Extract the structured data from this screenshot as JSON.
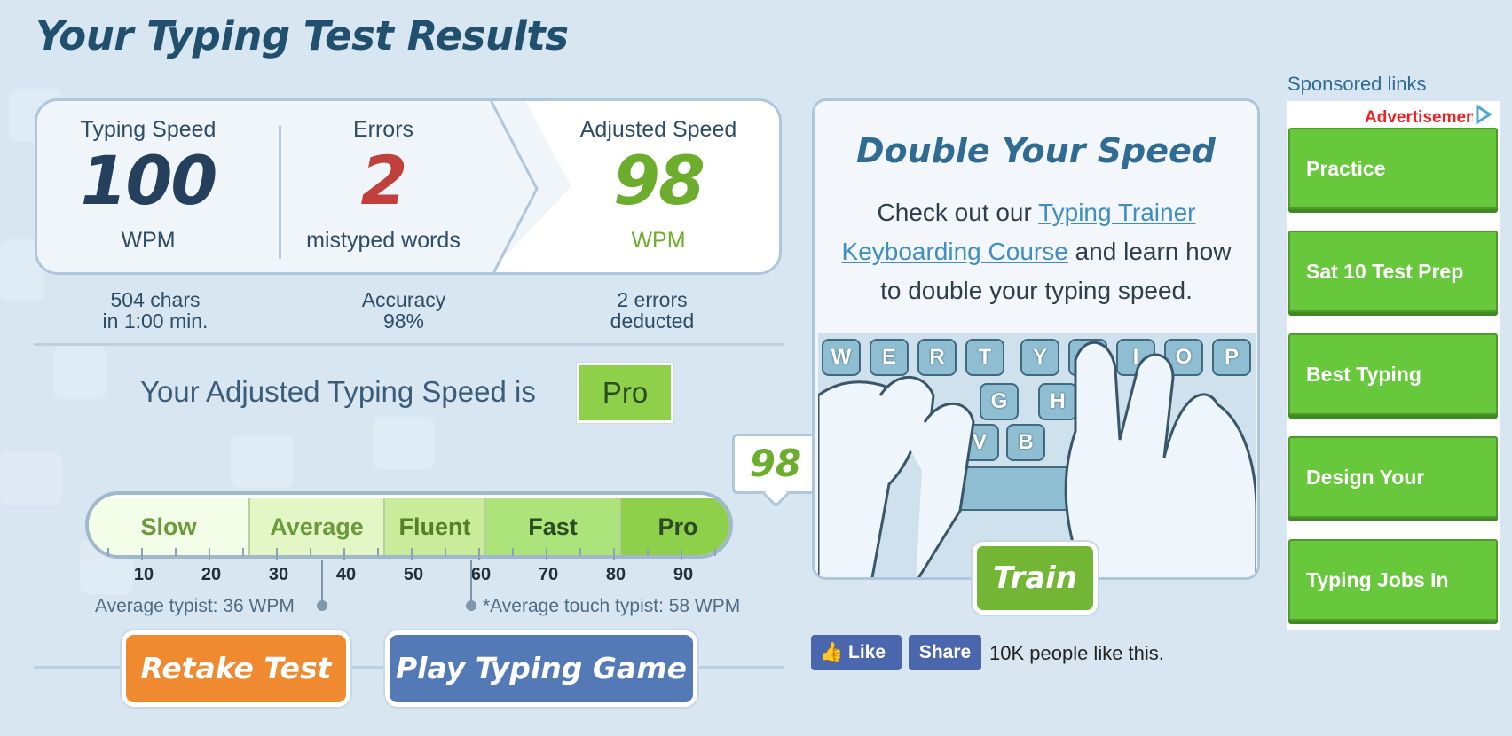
{
  "page": {
    "title": "Your Typing Test Results"
  },
  "results": {
    "typing_speed": {
      "label": "Typing Speed",
      "value": "100",
      "unit": "WPM"
    },
    "errors": {
      "label": "Errors",
      "value": "2",
      "unit": "mistyped words"
    },
    "adjusted_speed": {
      "label": "Adjusted Speed",
      "value": "98",
      "unit": "WPM"
    }
  },
  "stats": {
    "chars_line1": "504 chars",
    "chars_line2": "in 1:00 min.",
    "accuracy_line1": "Accuracy",
    "accuracy_line2": "98%",
    "deducted_line1": "2 errors",
    "deducted_line2": "deducted"
  },
  "rating": {
    "prefix": "Your Adjusted Typing Speed is",
    "level": "Pro"
  },
  "scale": {
    "segments": [
      "Slow",
      "Average",
      "Fluent",
      "Fast",
      "Pro"
    ],
    "numbers": [
      "10",
      "20",
      "30",
      "40",
      "50",
      "60",
      "70",
      "80",
      "90"
    ],
    "average_note": "Average typist: 36 WPM",
    "touch_note": "*Average touch typist: 58 WPM",
    "marker_value": "98",
    "colors": {
      "slow": "#f4fde8",
      "average": "#e3f6c6",
      "fluent": "#c9ec9b",
      "fast": "#ace37a",
      "pro": "#8fd04a"
    }
  },
  "actions": {
    "retake": "Retake Test",
    "play_game": "Play Typing Game"
  },
  "promo": {
    "title": "Double Your Speed",
    "text_before": "Check out our ",
    "link_text": "Typing Trainer Keyboarding Course",
    "text_after": " and learn how to double your typing speed.",
    "train_button": "Train",
    "keys_row1": [
      "W",
      "E",
      "R",
      "T",
      "Y",
      "U",
      "I",
      "O",
      "P"
    ],
    "keys_row2": [
      "G",
      "H"
    ],
    "keys_row3": [
      "V",
      "B"
    ]
  },
  "social": {
    "like": "Like",
    "share": "Share",
    "count_text": "10K people like this."
  },
  "sponsored": {
    "title": "Sponsored links",
    "ad_label": "Advertisement",
    "links": [
      "Practice",
      "Sat 10 Test Prep",
      "Best Typing",
      "Design Your",
      "Typing Jobs In"
    ]
  }
}
